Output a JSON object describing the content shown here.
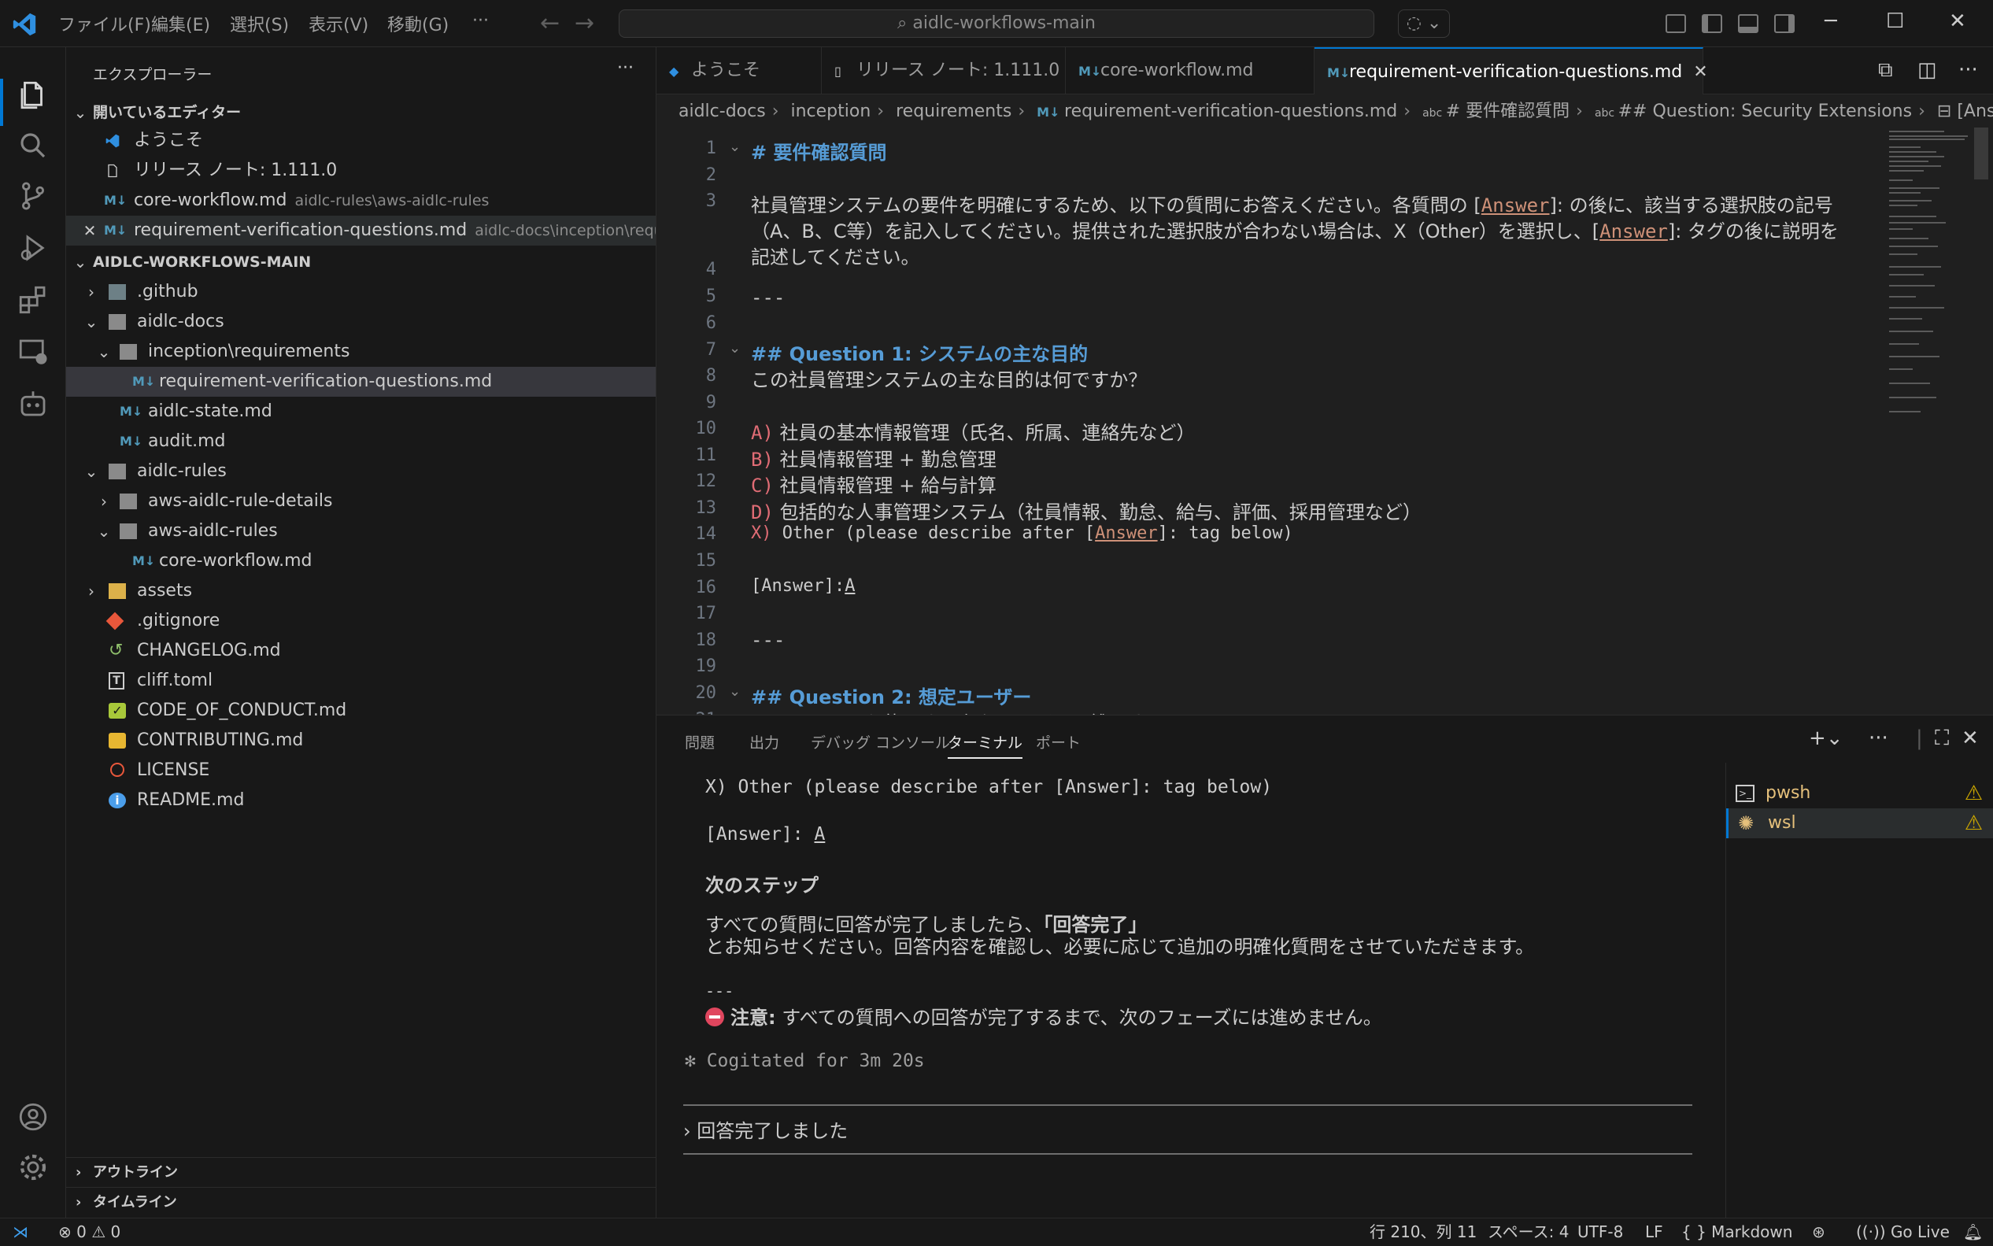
{
  "titlebar": {
    "menus": [
      "ファイル(F)",
      "編集(E)",
      "選択(S)",
      "表示(V)",
      "移動(G)",
      "···"
    ],
    "search_text": "aidlc-workflows-main"
  },
  "sidebar": {
    "title": "エクスプローラー",
    "open_editors_header": "開いているエディター",
    "open_editors": [
      {
        "name": "ようこそ",
        "hint": ""
      },
      {
        "name": "リリース ノート: 1.111.0",
        "hint": ""
      },
      {
        "name": "core-workflow.md",
        "hint": "aidlc-rules\\aws-aidlc-rules"
      },
      {
        "name": "requirement-verification-questions.md",
        "hint": "aidlc-docs\\inception\\requir..."
      }
    ],
    "workspace_header": "AIDLC-WORKFLOWS-MAIN",
    "tree": [
      ".github",
      "aidlc-docs",
      "inception\\requirements",
      "requirement-verification-questions.md",
      "aidlc-state.md",
      "audit.md",
      "aidlc-rules",
      "aws-aidlc-rule-details",
      "aws-aidlc-rules",
      "core-workflow.md",
      "assets",
      ".gitignore",
      "CHANGELOG.md",
      "cliff.toml",
      "CODE_OF_CONDUCT.md",
      "CONTRIBUTING.md",
      "LICENSE",
      "README.md"
    ],
    "outline": "アウトライン",
    "timeline": "タイムライン"
  },
  "tabs": [
    "ようこそ",
    "リリース ノート: 1.111.0",
    "core-workflow.md",
    "requirement-verification-questions.md"
  ],
  "breadcrumb": [
    "aidlc-docs",
    "inception",
    "requirements",
    "requirement-verification-questions.md",
    "# 要件確認質問",
    "## Question: Security Extensions",
    "[Answer]"
  ],
  "editor": {
    "line_numbers": [
      "1",
      "2",
      "3",
      "",
      "",
      "4",
      "5",
      "6",
      "7",
      "8",
      "9",
      "10",
      "11",
      "12",
      "13",
      "14",
      "15",
      "16",
      "17",
      "18",
      "19",
      "20",
      "21"
    ],
    "l1": "# 要件確認質問",
    "l3a": "社員管理システムの要件を明確にするため、以下の質問にお答えください。各質問の [",
    "l3a_tag": "Answer",
    "l3a_end": "]: の後に、該当する選択肢の記号",
    "l3b_pre": "（A、B、C等）を記入してください。提供された選択肢が合わない場合は、X（Other）を選択し、[",
    "l3b_tag": "Answer",
    "l3b_end": "]: タグの後に説明を",
    "l3c": "記述してください。",
    "l5": "---",
    "l7": "## Question 1: システムの主な目的",
    "l8": "この社員管理システムの主な目的は何ですか？",
    "opt_a_mark": "A)",
    "opt_a": "社員の基本情報管理（氏名、所属、連絡先など）",
    "opt_b_mark": "B)",
    "opt_b": "社員情報管理 + 勤怠管理",
    "opt_c_mark": "C)",
    "opt_c": "社員情報管理 + 給与計算",
    "opt_d_mark": "D)",
    "opt_d": "包括的な人事管理システム（社員情報、勤怠、給与、評価、採用管理など）",
    "opt_x_mark": "X)",
    "opt_x_pre": "Other (please describe after [",
    "opt_x_tag": "Answer",
    "opt_x_end": "]: tag below)",
    "l16_pre": "[Answer]:",
    "l16_val": "A",
    "l18": "---",
    "l20": "## Question 2: 想定ユーザー",
    "l21": "このシステムを使用する主なユーザーは誰ですか？"
  },
  "panel": {
    "tabs": [
      "問題",
      "出力",
      "デバッグ コンソール",
      "ターミナル",
      "ポート"
    ],
    "terminal": {
      "t1": "X) Other (please describe after [Answer]: tag below)",
      "t2_pre": "[Answer]:",
      "t2_val": "A",
      "t3": "次のステップ",
      "t4_pre": "すべての質問に回答が完了しましたら、",
      "t4_bold": "「回答完了」",
      "t5": "とお知らせください。回答内容を確認し、必要に応じて追加の明確化質問をさせていただきます。",
      "t6": "---",
      "t7_bold": "注意:",
      "t7": "すべての質問への回答が完了するまで、次のフェーズには進めません。",
      "t8": "✻ Cogitated for 3m 20s",
      "prompt": "回答完了しました"
    },
    "terminals": [
      "pwsh",
      "wsl"
    ]
  },
  "statusbar": {
    "errors": "0",
    "warnings": "0",
    "position": "行 210、列 11",
    "spaces": "スペース: 4",
    "encoding": "UTF-8",
    "eol": "LF",
    "language": "Markdown",
    "golive": "Go Live"
  },
  "colors": {
    "accent": "#0078d4",
    "heading": "#569cd6",
    "tag": "#ce9178",
    "list_mark": "#e06c75"
  }
}
